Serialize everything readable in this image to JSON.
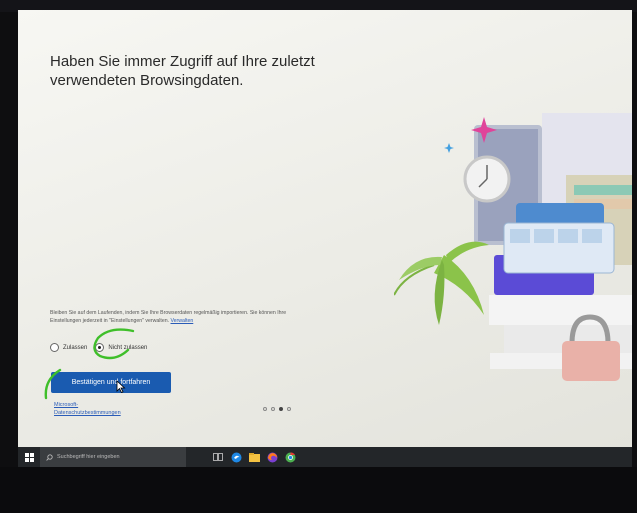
{
  "oobe": {
    "headline": "Haben Sie immer Zugriff auf Ihre zuletzt verwendeten Browsingdaten.",
    "description": "Bleiben Sie auf dem Laufenden, indem Sie Ihre Browserdaten regelmäßig importieren. Sie können Ihre Einstellungen jederzeit in \"Einstellungen\" verwalten.",
    "manage_link": "Verwalten",
    "radio_options": [
      {
        "label": "Zulassen",
        "checked": false
      },
      {
        "label": "Nicht zulassen",
        "checked": true
      }
    ],
    "confirm_button": "Bestätigen und fortfahren",
    "privacy_link": "Microsoft-Datenschutzbestimmungen",
    "pager": {
      "total": 4,
      "active": 3
    }
  },
  "taskbar": {
    "search_placeholder": "Suchbegriff hier eingeben",
    "icons": [
      "task-view-icon",
      "edge-icon",
      "file-explorer-icon",
      "firefox-icon",
      "chrome-icon"
    ]
  },
  "colors": {
    "accent": "#1a5bb0",
    "taskbar": "#232629",
    "pen_annotation": "#3fbf2a"
  }
}
